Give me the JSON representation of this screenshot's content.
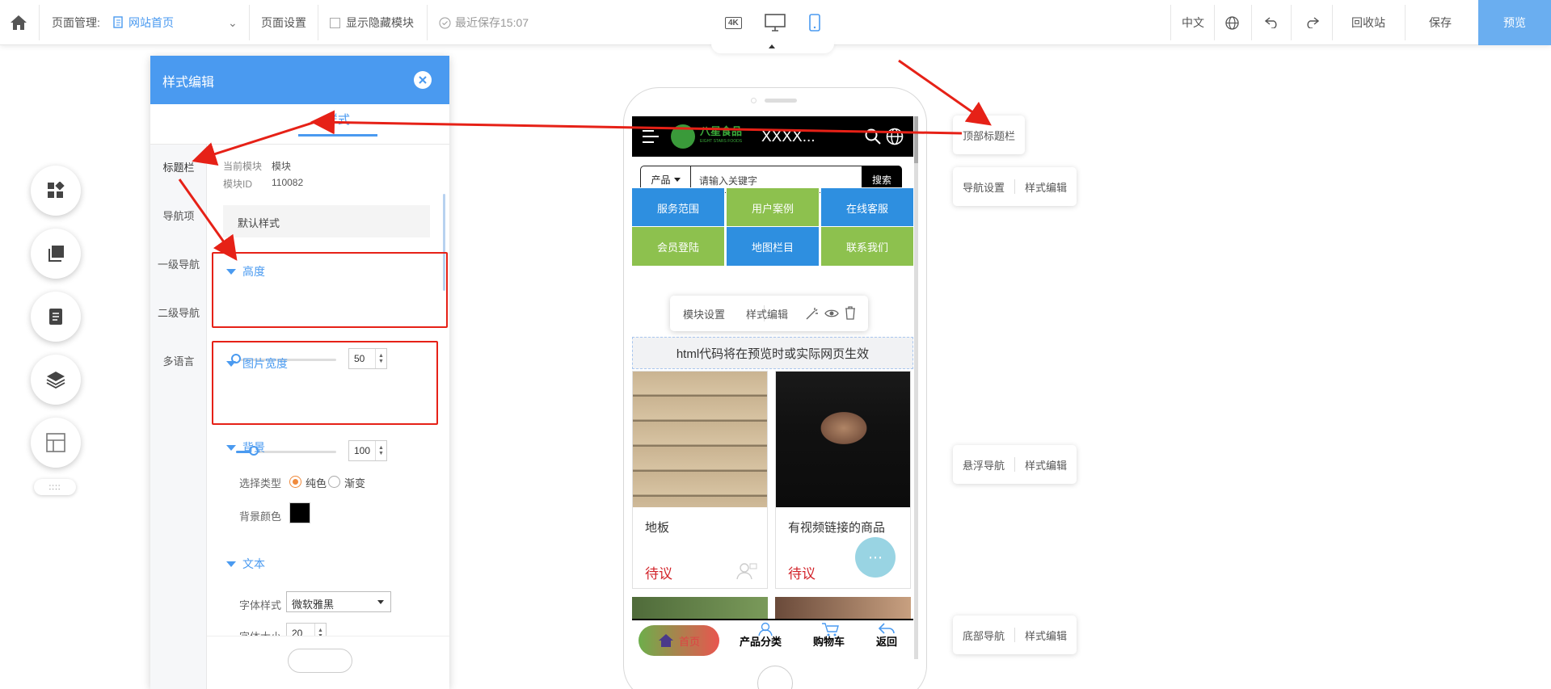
{
  "topbar": {
    "page_mgmt_label": "页面管理:",
    "current_page": "网站首页",
    "page_settings": "页面设置",
    "show_hidden": "显示隐藏模块",
    "last_saved": "最近保存15:07",
    "device_4k": "4K",
    "language": "中文",
    "recycle": "回收站",
    "save": "保存",
    "preview": "预览"
  },
  "panel": {
    "title": "样式编辑",
    "tab": "样式",
    "nav": [
      "标题栏",
      "导航项",
      "一级导航",
      "二级导航",
      "多语言"
    ],
    "current_module_label": "当前模块",
    "current_module_value": "模块",
    "module_id_label": "模块ID",
    "module_id_value": "110082",
    "default_style": "默认样式",
    "height": {
      "title": "高度",
      "value": "50",
      "fraction": 0.0
    },
    "img_width": {
      "title": "图片宽度",
      "value": "100",
      "fraction": 0.18
    },
    "background": {
      "title": "背景",
      "type_label": "选择类型",
      "solid": "纯色",
      "gradient": "渐变",
      "color_label": "背景颜色",
      "color": "#000000"
    },
    "text": {
      "title": "文本",
      "font_label": "字体样式",
      "font_value": "微软雅黑",
      "size_label": "字体大小",
      "size_value": "20"
    }
  },
  "phone": {
    "site_logo_text": "八星食品",
    "site_logo_sub": "EIGHT STARS FOODS",
    "site_name": "XXXX...",
    "search_category": "产品",
    "search_placeholder": "请输入关键字",
    "search_button": "搜索",
    "grid": [
      {
        "label": "服务范围",
        "color": "#2e8fe0"
      },
      {
        "label": "用户案例",
        "color": "#8dc14e"
      },
      {
        "label": "在线客服",
        "color": "#2e8fe0"
      },
      {
        "label": "会员登陆",
        "color": "#8dc14e"
      },
      {
        "label": "地图栏目",
        "color": "#2e8fe0"
      },
      {
        "label": "联系我们",
        "color": "#8dc14e"
      }
    ],
    "module_toolbar": {
      "settings": "模块设置",
      "style": "样式编辑"
    },
    "html_notice": "html代码将在预览时或实际网页生效",
    "products": [
      {
        "name": "地板",
        "price": "待议"
      },
      {
        "name": "有视频链接的商品",
        "price": "待议"
      }
    ],
    "bottom_nav": {
      "home": "首页",
      "category": "产品分类",
      "cart": "购物车",
      "back": "返回"
    }
  },
  "right_labels": {
    "top_title_bar": "顶部标题栏",
    "nav_settings": "导航设置",
    "style_edit": "样式编辑",
    "float_nav": "悬浮导航",
    "bottom_nav": "底部导航"
  },
  "colors": {
    "accent": "#4a9af0",
    "highlight": "#e62117"
  }
}
